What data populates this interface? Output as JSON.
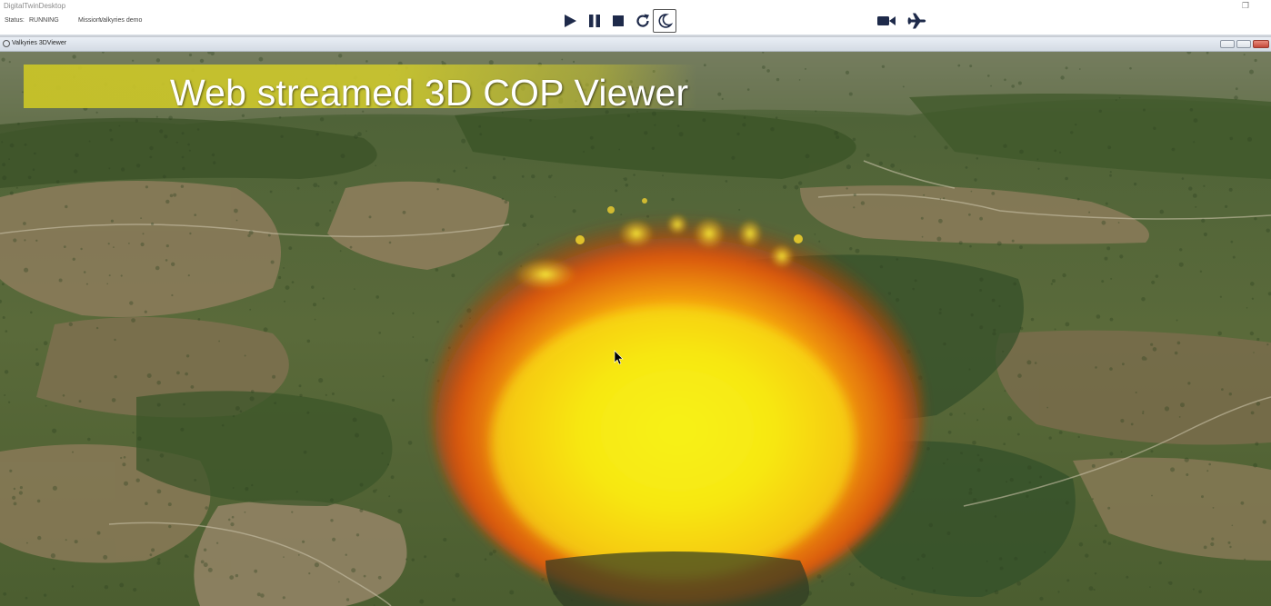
{
  "app": {
    "title": "DigitalTwinDesktop",
    "restore_glyph": "❐"
  },
  "status": {
    "label": "Status:",
    "value": "RUNNING"
  },
  "mission": {
    "label": "Mission:",
    "value": "Valkyries demo"
  },
  "controls": {
    "play_icon": "play-icon",
    "pause_icon": "pause-icon",
    "stop_icon": "stop-icon",
    "reload_icon": "reload-icon",
    "night_mode_icon": "moon-icon",
    "camera_icon": "video-camera-icon",
    "aircraft_icon": "airplane-icon",
    "icon_color": "#1e2a4a"
  },
  "viewer": {
    "window_title": "Valkyries 3DViewer",
    "banner_text": "Web streamed 3D COP Viewer",
    "banner_color": "#c8c22a",
    "fire_core_color": "#f5f010",
    "fire_mid_color": "#f59a0a",
    "fire_edge_color": "#c8380a",
    "terrain_colors": [
      "#3f5a2a",
      "#6b6a45",
      "#8c7a5a",
      "#4a6a33"
    ]
  }
}
